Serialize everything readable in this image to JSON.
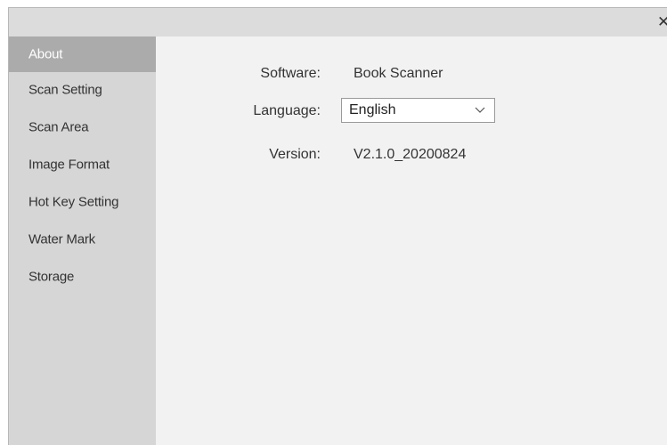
{
  "window": {
    "close_glyph": "✕"
  },
  "sidebar": {
    "items": [
      {
        "label": "About",
        "active": true
      },
      {
        "label": "Scan Setting",
        "active": false
      },
      {
        "label": "Scan Area",
        "active": false
      },
      {
        "label": "Image Format",
        "active": false
      },
      {
        "label": "Hot Key Setting",
        "active": false
      },
      {
        "label": "Water Mark",
        "active": false
      },
      {
        "label": "Storage",
        "active": false
      }
    ]
  },
  "about": {
    "software_label": "Software:",
    "software_value": "Book Scanner",
    "language_label": "Language:",
    "language_selected": "English",
    "version_label": "Version:",
    "version_value": "V2.1.0_20200824"
  },
  "colors": {
    "sidebar_bg": "#d6d6d6",
    "sidebar_active_bg": "#ababab",
    "content_bg": "#f2f2f2",
    "titlebar_bg": "#dcdcdc"
  },
  "icons": {
    "close": "close-icon",
    "dropdown": "chevron-down-icon"
  }
}
